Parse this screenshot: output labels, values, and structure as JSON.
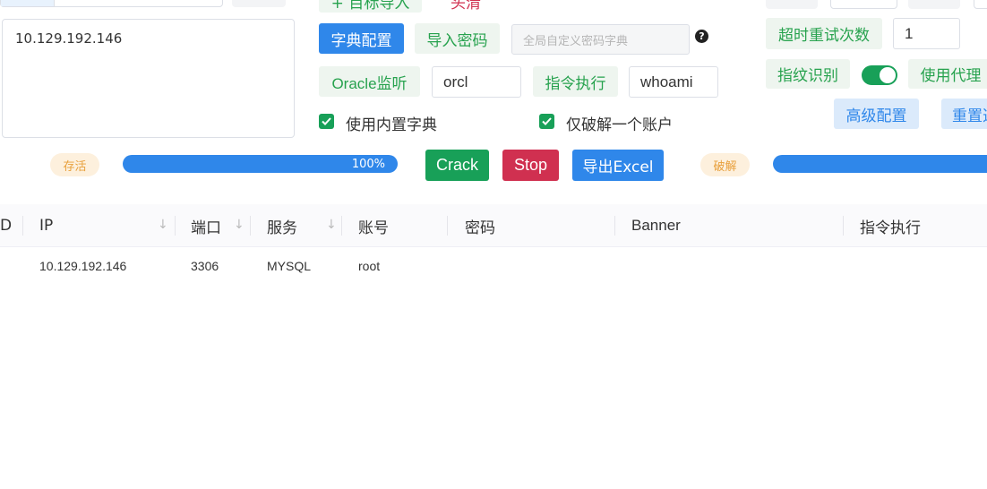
{
  "target": {
    "value": "10.129.192.146"
  },
  "toolbar": {
    "import_top_label": "+ 目标导入",
    "clear_top_label": "头清",
    "dict_config_label": "字典配置",
    "import_password_label": "导入密码",
    "global_dict_placeholder": "全局自定义密码字典",
    "help_label": "?",
    "oracle_listener_label": "Oracle监听",
    "oracle_sid_value": "orcl",
    "cmd_exec_label": "指令执行",
    "cmd_value": "whoami",
    "use_builtin_dict_label": "使用内置字典",
    "crack_one_account_label": "仅破解一个账户"
  },
  "right_panel": {
    "retry_label": "超时重试次数",
    "retry_value": "1",
    "fingerprint_label": "指纹识别",
    "fingerprint_enabled": true,
    "use_proxy_label": "使用代理",
    "advanced_label": "高级配置",
    "reset_label": "重置选"
  },
  "status": {
    "alive_tag": "存活",
    "alive_progress": 1.0,
    "alive_progress_text": "100%",
    "crack_button": "Crack",
    "stop_button": "Stop",
    "export_button": "导出Excel",
    "crack_tag": "破解"
  },
  "table": {
    "columns": [
      "D",
      "IP",
      "端口",
      "服务",
      "账号",
      "密码",
      "Banner",
      "指令执行"
    ],
    "rows": [
      {
        "ip": "10.129.192.146",
        "port": "3306",
        "service": "MYSQL",
        "account": "root",
        "password": "",
        "banner": "",
        "cmd": ""
      }
    ]
  },
  "colors": {
    "primary": "#2f87ea",
    "success": "#18a058",
    "danger": "#d03050",
    "warning": "#e8a03c"
  }
}
